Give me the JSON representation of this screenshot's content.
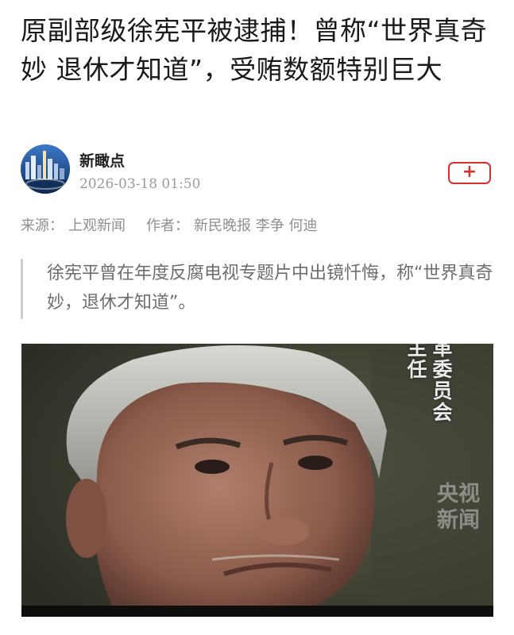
{
  "article": {
    "headline": "原副部级徐宪平被逮捕！曾称“世界真奇妙 退休才知道”，受贿数额特别巨大",
    "author": {
      "name": "新瞰点",
      "time": "2026-03-18 01:50"
    },
    "follow_label": "+",
    "source_label": "来源：",
    "source_value": "上观新闻",
    "writer_label": "作者：",
    "writer_value": "新民晚报 李争 何迪",
    "summary": "徐宪平曾在年度反腐电视专题片中出镜忏悔，称“世界真奇妙，退休才知道”。"
  },
  "image": {
    "caption_col1": "主任",
    "caption_col2": "革委员会",
    "watermark": "央视新闻"
  },
  "colors": {
    "accent": "#d9302d",
    "meta_text": "#9a9a9a"
  },
  "icons": {
    "avatar": "city-night-avatar",
    "follow": "plus-icon"
  }
}
